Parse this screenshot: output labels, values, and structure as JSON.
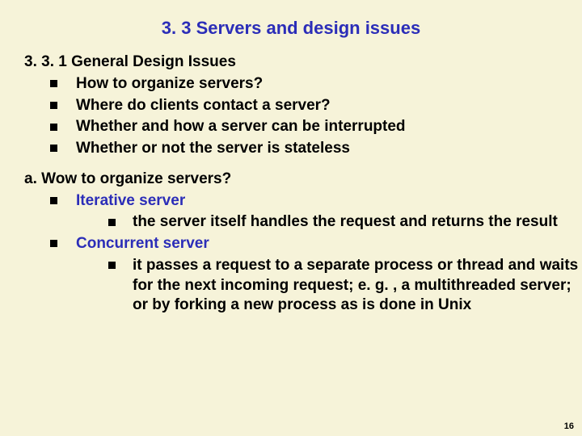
{
  "title": "3. 3 Servers and design issues",
  "section1": {
    "heading": "3. 3. 1 General Design Issues",
    "items": [
      "How to organize servers?",
      "Where do clients contact a server?",
      "Whether and how a server can be interrupted",
      "Whether or not the server is stateless"
    ]
  },
  "sectionA": {
    "heading": "a. Wow to organize servers?",
    "items": [
      {
        "label": "Iterative server",
        "sub": [
          "the server itself handles the request and returns the result"
        ]
      },
      {
        "label": "Concurrent server",
        "sub": [
          "it passes a request to a separate process or thread and waits for the next incoming request; e. g. , a multithreaded server; or by forking  a new process as is done in Unix"
        ]
      }
    ]
  },
  "pageNumber": "16"
}
